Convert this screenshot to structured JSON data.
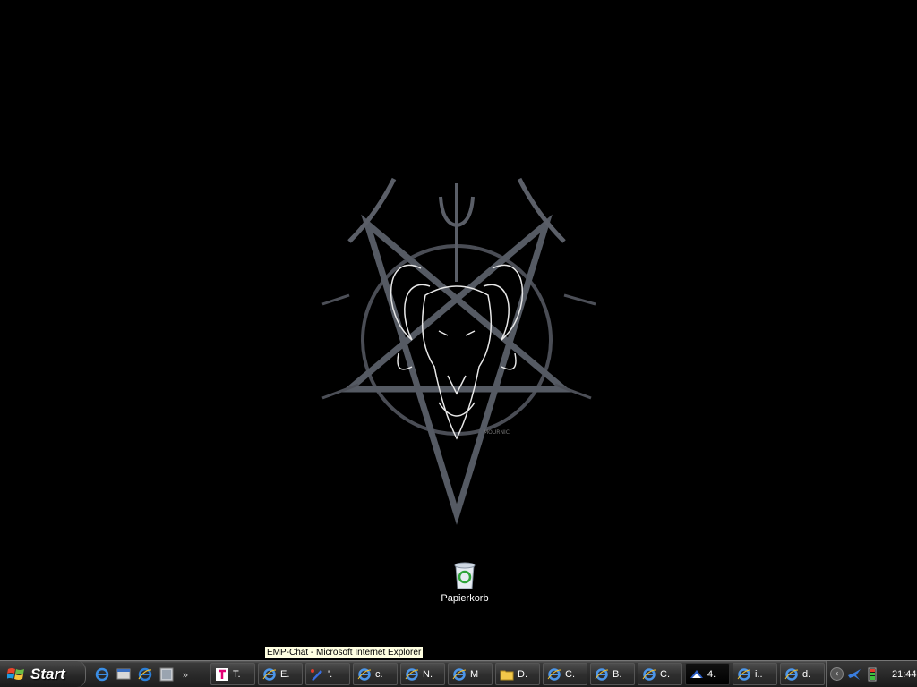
{
  "desktop": {
    "background_color": "#000000",
    "icons": [
      {
        "name": "recycle-bin-icon",
        "label": "Papierkorb"
      }
    ]
  },
  "tooltip": {
    "text": "EMP-Chat - Microsoft Internet Explorer"
  },
  "taskbar": {
    "start_label": "Start",
    "quick_launch": [
      "ie-icon",
      "show-desktop-icon",
      "ie-icon",
      "window-icon"
    ],
    "quick_launch_more": "»",
    "tasks": [
      {
        "label": "T.",
        "icon": "t-online-icon",
        "active": false
      },
      {
        "label": "E.",
        "icon": "ie-icon",
        "active": false
      },
      {
        "label": "'.",
        "icon": "pen-icon",
        "active": false
      },
      {
        "label": "c.",
        "icon": "ie-icon",
        "active": false
      },
      {
        "label": "N.",
        "icon": "ie-icon",
        "active": false
      },
      {
        "label": "M",
        "icon": "ie-icon",
        "active": false
      },
      {
        "label": "D.",
        "icon": "folder-icon",
        "active": false
      },
      {
        "label": "C.",
        "icon": "ie-icon",
        "active": false
      },
      {
        "label": "B.",
        "icon": "ie-icon",
        "active": false
      },
      {
        "label": "C.",
        "icon": "ie-icon",
        "active": false
      },
      {
        "label": "4.",
        "icon": "messenger-icon",
        "active": true
      },
      {
        "label": "i..",
        "icon": "ie-icon",
        "active": false
      },
      {
        "label": "d.",
        "icon": "ie-icon",
        "active": false
      }
    ],
    "tray": {
      "expand_label": "‹",
      "icons": [
        "network-bird-icon",
        "volume-meter-icon"
      ],
      "clock": "21:44"
    }
  }
}
